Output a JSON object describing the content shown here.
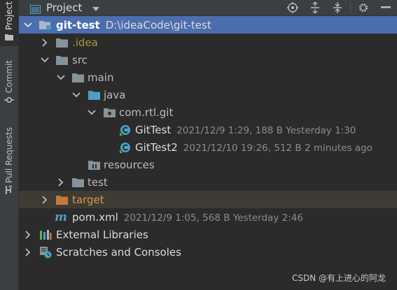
{
  "side_tabs": [
    {
      "label": "Project",
      "icon": "folder-icon"
    },
    {
      "label": "Commit",
      "icon": "commit-icon"
    },
    {
      "label": "Pull Requests",
      "icon": "pull-request-icon"
    }
  ],
  "header": {
    "title": "Project",
    "tools": [
      "locate-icon",
      "expand-all-icon",
      "collapse-all-icon",
      "gear-icon",
      "minimize-icon"
    ]
  },
  "tree": {
    "root": {
      "name": "git-test",
      "path": "D:\\ideaCode\\git-test"
    },
    "idea": ".idea",
    "src": "src",
    "main": "main",
    "java": "java",
    "package": "com.rtl.git",
    "files": [
      {
        "name": "GitTest",
        "meta": "2021/12/9 1:29, 188 B Yesterday 1:30"
      },
      {
        "name": "GitTest2",
        "meta": "2021/12/10 19:26, 512 B 2 minutes ago"
      }
    ],
    "resources": "resources",
    "test": "test",
    "target": "target",
    "pom": {
      "name": "pom.xml",
      "meta": "2021/12/9 1:05, 568 B Yesterday 2:46"
    },
    "external_libraries": "External Libraries",
    "scratches": "Scratches and Consoles"
  },
  "watermark": "CSDN @有上进心的阿龙",
  "colors": {
    "selection": "#4b6eaf",
    "folder": "#87939a",
    "source_folder": "#4f9ec4",
    "class_icon": "#4aa3c9",
    "target_folder": "#c7793a"
  }
}
